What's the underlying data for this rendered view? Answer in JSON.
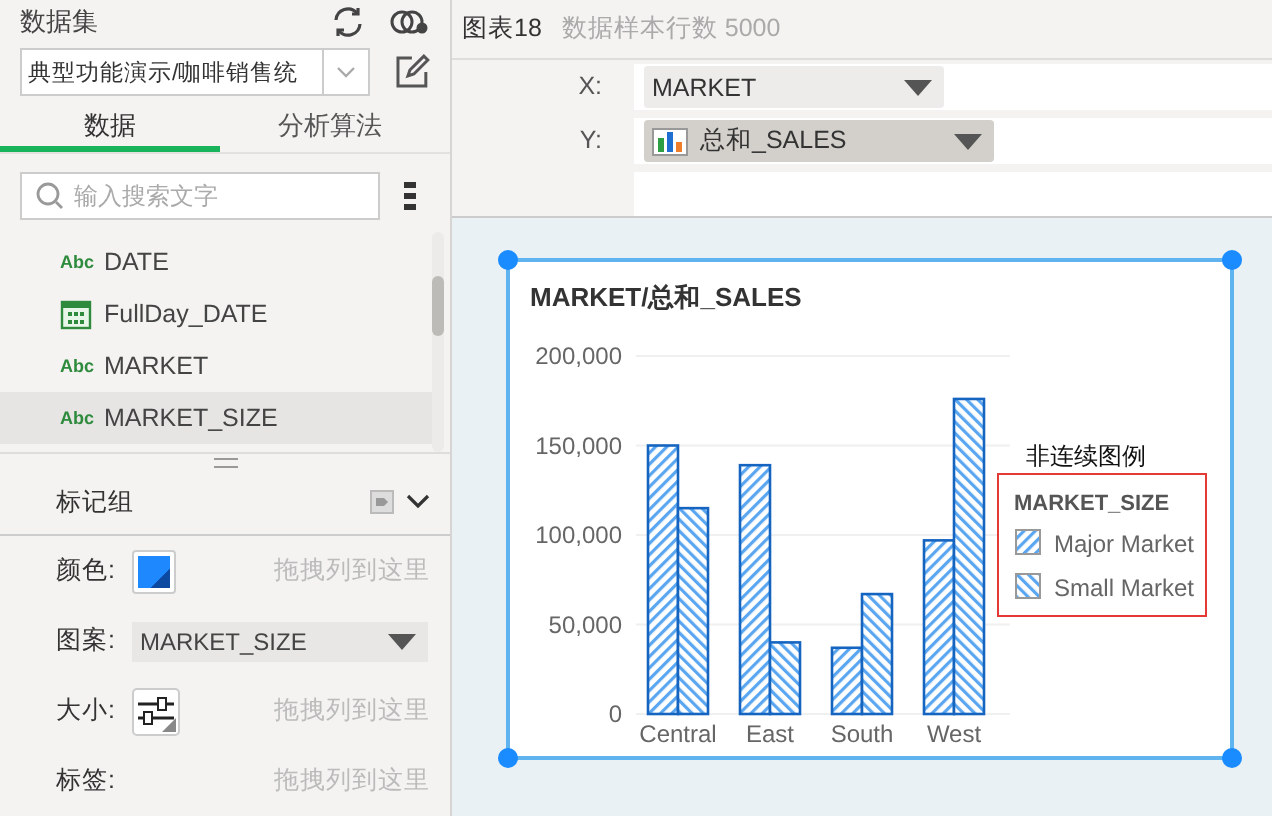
{
  "dataset": {
    "label": "数据集",
    "value": "典型功能演示/咖啡销售统"
  },
  "left_tabs": [
    {
      "label": "数据",
      "selected": true
    },
    {
      "label": "分析算法",
      "selected": false
    }
  ],
  "field_search": {
    "placeholder": "输入搜索文字"
  },
  "fields": [
    {
      "name": "DATE",
      "kind": "text",
      "type_label": "Abc",
      "selected": false
    },
    {
      "name": "FullDay_DATE",
      "kind": "date",
      "selected": false
    },
    {
      "name": "MARKET",
      "kind": "text",
      "type_label": "Abc",
      "selected": false
    },
    {
      "name": "MARKET_SIZE",
      "kind": "text",
      "type_label": "Abc",
      "selected": true
    }
  ],
  "marks": {
    "title": "标记组",
    "rows": [
      {
        "label": "颜色:",
        "kind": "swatch",
        "placeholder": "拖拽列到这里"
      },
      {
        "label": "图案:",
        "kind": "dropdown",
        "value": "MARKET_SIZE"
      },
      {
        "label": "大小:",
        "kind": "size",
        "placeholder": "拖拽列到这里"
      },
      {
        "label": "标签:",
        "kind": "empty",
        "placeholder": "拖拽列到这里"
      }
    ]
  },
  "chart_header": {
    "title": "图表18",
    "sample_rows": "数据样本行数 5000"
  },
  "shelves": [
    {
      "label": "X:",
      "value": "MARKET",
      "kind": "dimension"
    },
    {
      "label": "Y:",
      "value": "总和_SALES",
      "kind": "measure"
    }
  ],
  "chart": {
    "legend_caption": "非连续图例",
    "legend_title": "MARKET_SIZE",
    "chart_data": {
      "type": "bar",
      "title": "MARKET/总和_SALES",
      "categories": [
        "Central",
        "East",
        "South",
        "West"
      ],
      "series": [
        {
          "name": "Major Market",
          "color": "#1565c0",
          "values": [
            150000,
            139000,
            37000,
            97000
          ]
        },
        {
          "name": "Small Market",
          "color": "#1565c0",
          "values": [
            115000,
            40000,
            67000,
            176000
          ]
        }
      ],
      "ylim": [
        0,
        200000
      ],
      "grid": true,
      "legend": true,
      "yticks": [
        {
          "value": 0,
          "label": "0"
        },
        {
          "value": 50000,
          "label": "50,000"
        },
        {
          "value": 100000,
          "label": "100,000"
        },
        {
          "value": 150000,
          "label": "150,000"
        },
        {
          "value": 200000,
          "label": "200,000"
        }
      ]
    }
  }
}
